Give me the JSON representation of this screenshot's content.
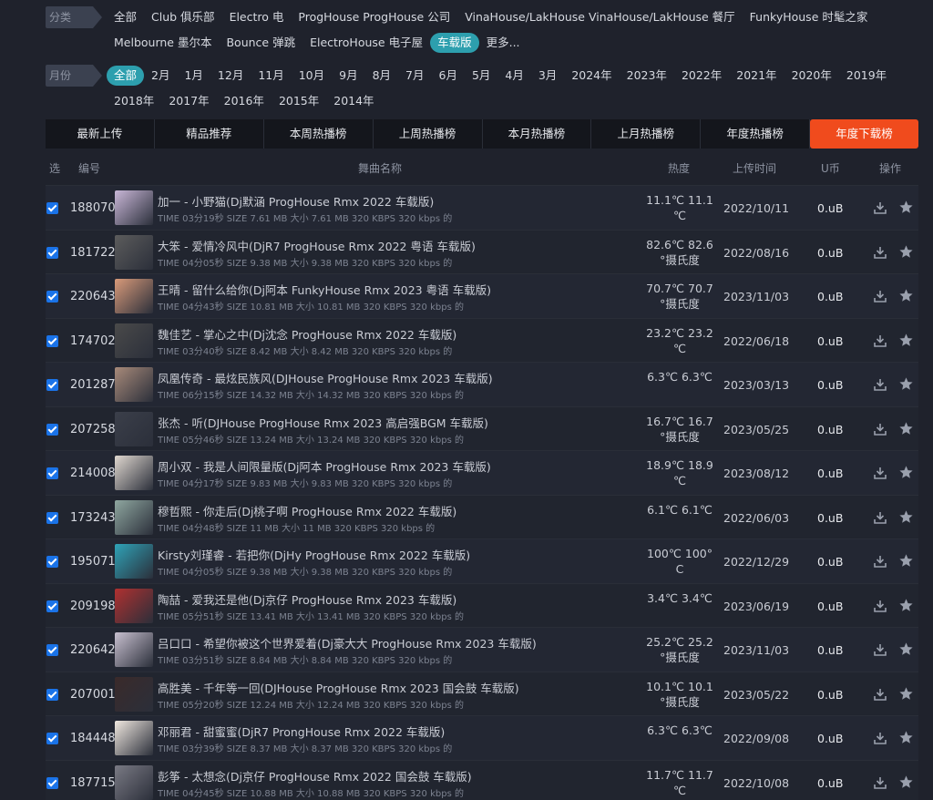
{
  "category": {
    "label": "分类",
    "items": [
      {
        "label": "全部",
        "active": false
      },
      {
        "label": "Club  俱乐部",
        "active": false
      },
      {
        "label": "Electro  电",
        "active": false
      },
      {
        "label": "ProgHouse  ProgHouse 公司",
        "active": false
      },
      {
        "label": "VinaHouse/LakHouse  VinaHouse/LakHouse 餐厅",
        "active": false
      },
      {
        "label": "FunkyHouse  时髦之家",
        "active": false
      },
      {
        "label": "Melbourne  墨尔本",
        "active": false
      },
      {
        "label": "Bounce  弹跳",
        "active": false
      },
      {
        "label": "ElectroHouse  电子屋",
        "active": false
      },
      {
        "label": "车载版",
        "active": true
      },
      {
        "label": "更多...",
        "active": false
      }
    ]
  },
  "month": {
    "label": "月份",
    "items": [
      {
        "label": "全部",
        "active": true
      },
      {
        "label": "2月",
        "active": false
      },
      {
        "label": "1月",
        "active": false
      },
      {
        "label": "12月",
        "active": false
      },
      {
        "label": "11月",
        "active": false
      },
      {
        "label": "10月",
        "active": false
      },
      {
        "label": "9月",
        "active": false
      },
      {
        "label": "8月",
        "active": false
      },
      {
        "label": "7月",
        "active": false
      },
      {
        "label": "6月",
        "active": false
      },
      {
        "label": "5月",
        "active": false
      },
      {
        "label": "4月",
        "active": false
      },
      {
        "label": "3月",
        "active": false
      },
      {
        "label": "2024年",
        "active": false
      },
      {
        "label": "2023年",
        "active": false
      },
      {
        "label": "2022年",
        "active": false
      },
      {
        "label": "2021年",
        "active": false
      },
      {
        "label": "2020年",
        "active": false
      },
      {
        "label": "2019年",
        "active": false
      },
      {
        "label": "2018年",
        "active": false
      },
      {
        "label": "2017年",
        "active": false
      },
      {
        "label": "2016年",
        "active": false
      },
      {
        "label": "2015年",
        "active": false
      },
      {
        "label": "2014年",
        "active": false
      }
    ]
  },
  "tabs": [
    {
      "label": "最新上传",
      "active": false
    },
    {
      "label": "精品推荐",
      "active": false
    },
    {
      "label": "本周热播榜",
      "active": false
    },
    {
      "label": "上周热播榜",
      "active": false
    },
    {
      "label": "本月热播榜",
      "active": false
    },
    {
      "label": "上月热播榜",
      "active": false
    },
    {
      "label": "年度热播榜",
      "active": false
    },
    {
      "label": "年度下载榜",
      "active": true
    }
  ],
  "columns": {
    "select": "选",
    "id": "编号",
    "name": "舞曲名称",
    "heat": "热度",
    "upload_time": "上传时间",
    "coin": "U币",
    "action": "操作"
  },
  "icons": {
    "checkbox": "checked-checkbox-icon",
    "download": "download-icon",
    "favorite": "star-icon"
  },
  "thumb_colors": [
    "#c9b7d8",
    "#5c5c5c",
    "#d99a7a",
    "#4a4a4a",
    "#a88a7a",
    "#3b3f4a",
    "#e0d8d0",
    "#8fa7a0",
    "#2fa3b8",
    "#b03030",
    "#c8c0d0",
    "#3a2a2a",
    "#f0e8e0",
    "#7a7a84"
  ],
  "rows": [
    {
      "id": "188070",
      "title": "加一 - 小野猫(Dj默涵 ProgHouse Rmx 2022 车载版)",
      "meta": "TIME 03分19秒    SIZE 7.61 MB    大小 7.61 MB    320 KBPS    320 kbps 的",
      "heat1": "11.1℃  11.1",
      "heat2": "℃",
      "date": "2022/10/11",
      "coin": "0.uB"
    },
    {
      "id": "181722",
      "title": "大笨 - 爱情冷风中(DjR7 ProgHouse Rmx 2022 粤语 车载版)",
      "meta": "TIME 04分05秒    SIZE 9.38 MB    大小 9.38 MB    320 KBPS    320 kbps 的",
      "heat1": "82.6℃  82.6",
      "heat2": "°摄氏度",
      "date": "2022/08/16",
      "coin": "0.uB"
    },
    {
      "id": "220643",
      "title": "王晴 - 留什么给你(Dj阿本 FunkyHouse Rmx 2023 粤语 车载版)",
      "meta": "TIME 04分43秒    SIZE 10.81 MB    大小 10.81 MB    320 KBPS    320 kbps 的",
      "heat1": "70.7℃  70.7",
      "heat2": "°摄氏度",
      "date": "2023/11/03",
      "coin": "0.uB"
    },
    {
      "id": "174702",
      "title": "魏佳艺 - 掌心之中(Dj沈念 ProgHouse Rmx 2022 车载版)",
      "meta": "TIME 03分40秒    SIZE 8.42 MB    大小 8.42 MB    320 KBPS    320 kbps 的",
      "heat1": "23.2℃  23.2",
      "heat2": "℃",
      "date": "2022/06/18",
      "coin": "0.uB"
    },
    {
      "id": "201287",
      "title": "凤凰传奇 - 最炫民族风(DJHouse ProgHouse Rmx 2023 车载版)",
      "meta": "TIME 06分15秒    SIZE 14.32 MB    大小 14.32 MB    320 KBPS    320 kbps 的",
      "heat1": "6.3℃  6.3℃",
      "heat2": "",
      "date": "2023/03/13",
      "coin": "0.uB"
    },
    {
      "id": "207258",
      "title": "张杰 - 听(DJHouse ProgHouse Rmx 2023 高启强BGM 车载版)",
      "meta": "TIME 05分46秒    SIZE 13.24 MB    大小 13.24 MB    320 KBPS    320 kbps 的",
      "heat1": "16.7℃  16.7",
      "heat2": "°摄氏度",
      "date": "2023/05/25",
      "coin": "0.uB"
    },
    {
      "id": "214008",
      "title": "周小双 - 我是人间限量版(Dj阿本 ProgHouse Rmx 2023 车载版)",
      "meta": "TIME 04分17秒    SIZE 9.83 MB    大小 9.83 MB    320 KBPS    320 kbps 的",
      "heat1": "18.9℃  18.9",
      "heat2": "℃",
      "date": "2023/08/12",
      "coin": "0.uB"
    },
    {
      "id": "173243",
      "title": "穆哲熙 - 你走后(Dj桃子啊 ProgHouse Rmx 2022 车载版)",
      "meta": "TIME 04分48秒    SIZE 11 MB    大小 11 MB    320 KBPS    320 kbps 的",
      "heat1": "6.1℃  6.1℃",
      "heat2": "",
      "date": "2022/06/03",
      "coin": "0.uB"
    },
    {
      "id": "195071",
      "title": "Kirsty刘瑾睿 - 若把你(DjHy ProgHouse Rmx 2022 车载版)",
      "meta": "TIME 04分05秒    SIZE 9.38 MB    大小 9.38 MB    320 KBPS    320 kbps 的",
      "heat1": "100℃  100°",
      "heat2": "C",
      "date": "2022/12/29",
      "coin": "0.uB"
    },
    {
      "id": "209198",
      "title": "陶喆 - 爱我还是他(Dj京仔 ProgHouse Rmx 2023 车载版)",
      "meta": "TIME 05分51秒    SIZE 13.41 MB    大小 13.41 MB    320 KBPS    320 kbps 的",
      "heat1": "3.4℃  3.4℃",
      "heat2": "",
      "date": "2023/06/19",
      "coin": "0.uB"
    },
    {
      "id": "220642",
      "title": "吕口口 - 希望你被这个世界爱着(Dj豪大大 ProgHouse Rmx 2023 车载版)",
      "meta": "TIME 03分51秒    SIZE 8.84 MB    大小 8.84 MB    320 KBPS    320 kbps 的",
      "heat1": "25.2℃  25.2",
      "heat2": "°摄氏度",
      "date": "2023/11/03",
      "coin": "0.uB"
    },
    {
      "id": "207001",
      "title": "高胜美 - 千年等一回(DJHouse ProgHouse Rmx 2023 国会鼓 车载版)",
      "meta": "TIME 05分20秒    SIZE 12.24 MB    大小 12.24 MB    320 KBPS    320 kbps 的",
      "heat1": "10.1℃  10.1",
      "heat2": "°摄氏度",
      "date": "2023/05/22",
      "coin": "0.uB"
    },
    {
      "id": "184448",
      "title": "邓丽君 - 甜蜜蜜(DjR7 ProngHouse Rmx 2022 车载版)",
      "meta": "TIME 03分39秒    SIZE 8.37 MB    大小 8.37 MB    320 KBPS    320 kbps 的",
      "heat1": "6.3℃  6.3℃",
      "heat2": "",
      "date": "2022/09/08",
      "coin": "0.uB"
    },
    {
      "id": "187715",
      "title": "彭筝 - 太想念(Dj京仔 ProgHouse Rmx 2022 国会鼓 车载版)",
      "meta": "TIME 04分45秒    SIZE 10.88 MB    大小 10.88 MB    320 KBPS    320 kbps 的",
      "heat1": "11.7℃  11.7",
      "heat2": "℃",
      "date": "2022/10/08",
      "coin": "0.uB"
    }
  ]
}
